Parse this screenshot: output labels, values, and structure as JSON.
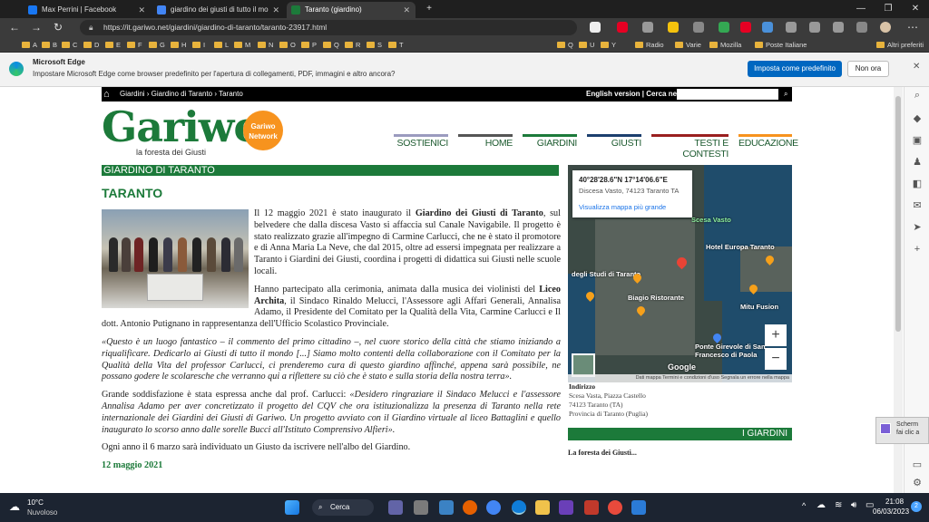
{
  "browser": {
    "tabs": [
      {
        "title": "Max Perrini | Facebook",
        "active": false,
        "favicon_color": "#1877f2"
      },
      {
        "title": "giardino dei giusti di tutto il mo",
        "active": false,
        "favicon_color": "#4285f4"
      },
      {
        "title": "Taranto (giardino)",
        "active": true,
        "favicon_color": "#1c7a3a"
      }
    ],
    "new_tab": "+",
    "url": "https://it.gariwo.net/giardini/giardino-di-taranto/taranto-23917.html",
    "bookmarks": [
      "A",
      "B",
      "C",
      "D",
      "E",
      "F",
      "G",
      "H",
      "I",
      "L",
      "M",
      "N",
      "O",
      "P",
      "Q",
      "R",
      "S",
      "T",
      "Q",
      "U",
      "Y",
      "Radio",
      "Varie",
      "Mozilla",
      "Poste Italiane",
      "Altri preferiti"
    ],
    "infobar": {
      "title": "Microsoft Edge",
      "message": "Impostare Microsoft Edge come browser predefinito per l'apertura di collegamenti, PDF, immagini e altro ancora?",
      "primary": "Imposta come predefinito",
      "secondary": "Non ora"
    }
  },
  "site": {
    "breadcrumb": "Giardini › Giardino di Taranto › Taranto",
    "topbar_right": "English version | Cerca nel sito:",
    "logo": "Gariwo",
    "logo_sub": "la foresta dei Giusti",
    "network_badge": "Gariwo Network",
    "menu": [
      {
        "label": "SOSTIENICI",
        "color": "#9b9bbf"
      },
      {
        "label": "HOME",
        "color": "#555555"
      },
      {
        "label": "GIARDINI",
        "color": "#1c7a3a"
      },
      {
        "label": "GIUSTI",
        "color": "#1c3f6e"
      },
      {
        "label": "TESTI E CONTESTI",
        "color": "#9a1f1f"
      },
      {
        "label": "EDUCAZIONE",
        "color": "#f7931e"
      }
    ]
  },
  "article": {
    "section": "GIARDINO DI TARANTO",
    "title": "TARANTO",
    "p1_a": "Il 12 maggio 2021 è stato inaugurato il ",
    "p1_b": "Giardino dei Giusti di Taranto",
    "p1_c": ", sul belvedere che dalla discesa Vasto si affaccia sul Canale Navigabile. Il progetto è stato realizzato grazie all'impegno di Carmine Carlucci, che ne è stato il promotore e di Anna Maria La Neve, che dal 2015, oltre ad essersi impegnata per realizzare a Taranto i Giardini dei Giusti, coordina i progetti di didattica sui Giusti nelle scuole locali.",
    "p2_a": "Hanno partecipato alla cerimonia, animata dalla musica dei violinisti del ",
    "p2_b": "Liceo Archita",
    "p2_c": ", il Sindaco Rinaldo Melucci, l'Assessore agli Affari Generali, Annalisa Adamo, il Presidente del Comitato per la Qualità della Vita, Carmine Carlucci e Il dott. Antonio Putignano in rappresentanza dell'Ufficio Scolastico Provinciale.",
    "p3": "«Questo è un luogo fantastico – il commento del primo cittadino –, nel cuore storico della città che stiamo iniziando a riqualificare. Dedicarlo ai Giusti di tutto il mondo [...] Siamo molto contenti della collaborazione con il Comitato per la Qualità della Vita del professor Carlucci, ci prenderemo cura di questo giardino affinché, appena sarà possibile, ne possano godere le scolaresche che verranno qui a riflettere su ciò che è stato e sulla storia della nostra terra».",
    "p4_a": "Grande soddisfazione è stata espressa anche dal prof. Carlucci: ",
    "p4_b": "«Desidero ringraziare il Sindaco Melucci e l'assessore Annalisa Adamo per aver concretizzato il progetto del CQV che ora istituzionalizza la presenza di Taranto nella rete internazionale dei Giardini dei Giusti di Gariwo. Un progetto avviato con il Giardino virtuale al liceo Battaglini e quello inaugurato lo scorso anno dalle sorelle Bucci all'Istituto Comprensivo Alfieri».",
    "p5": "Ogni anno il 6 marzo sarà individuato un Giusto da iscrivere nell'albo del Giardino.",
    "date": "12 maggio 2021"
  },
  "map": {
    "coords": "40°28'28.6\"N 17°14'06.6\"E",
    "place": "Discesa Vasto, 74123 Taranto TA",
    "link": "Visualizza mappa più grande",
    "labels": [
      "Scesa Vasto",
      "Hotel Europa Taranto",
      "degli Studi di Taranto",
      "Biagio Ristorante",
      "Mitu Fusion",
      "Ponte Girevole di San Francesco di Paola",
      "Google"
    ],
    "footer": "Dati mappa   Termini e condizioni d'uso   Segnala un errore nella mappa",
    "zoom_in": "+",
    "zoom_out": "−"
  },
  "address": {
    "label": "Indirizzo",
    "lines": [
      "Scesa Vasta, Piazza Castello",
      "74123 Taranto (TA)",
      "Provincia di Taranto (Puglia)"
    ]
  },
  "sidebox": {
    "title": "I GIARDINI",
    "link": "La foresta dei Giusti..."
  },
  "notification": {
    "line1": "Scherm",
    "line2": "fai clic a"
  },
  "taskbar": {
    "weather_temp": "10°C",
    "weather_desc": "Nuvoloso",
    "search": "Cerca",
    "time": "21:08",
    "date": "06/03/2023",
    "badge": "2"
  }
}
